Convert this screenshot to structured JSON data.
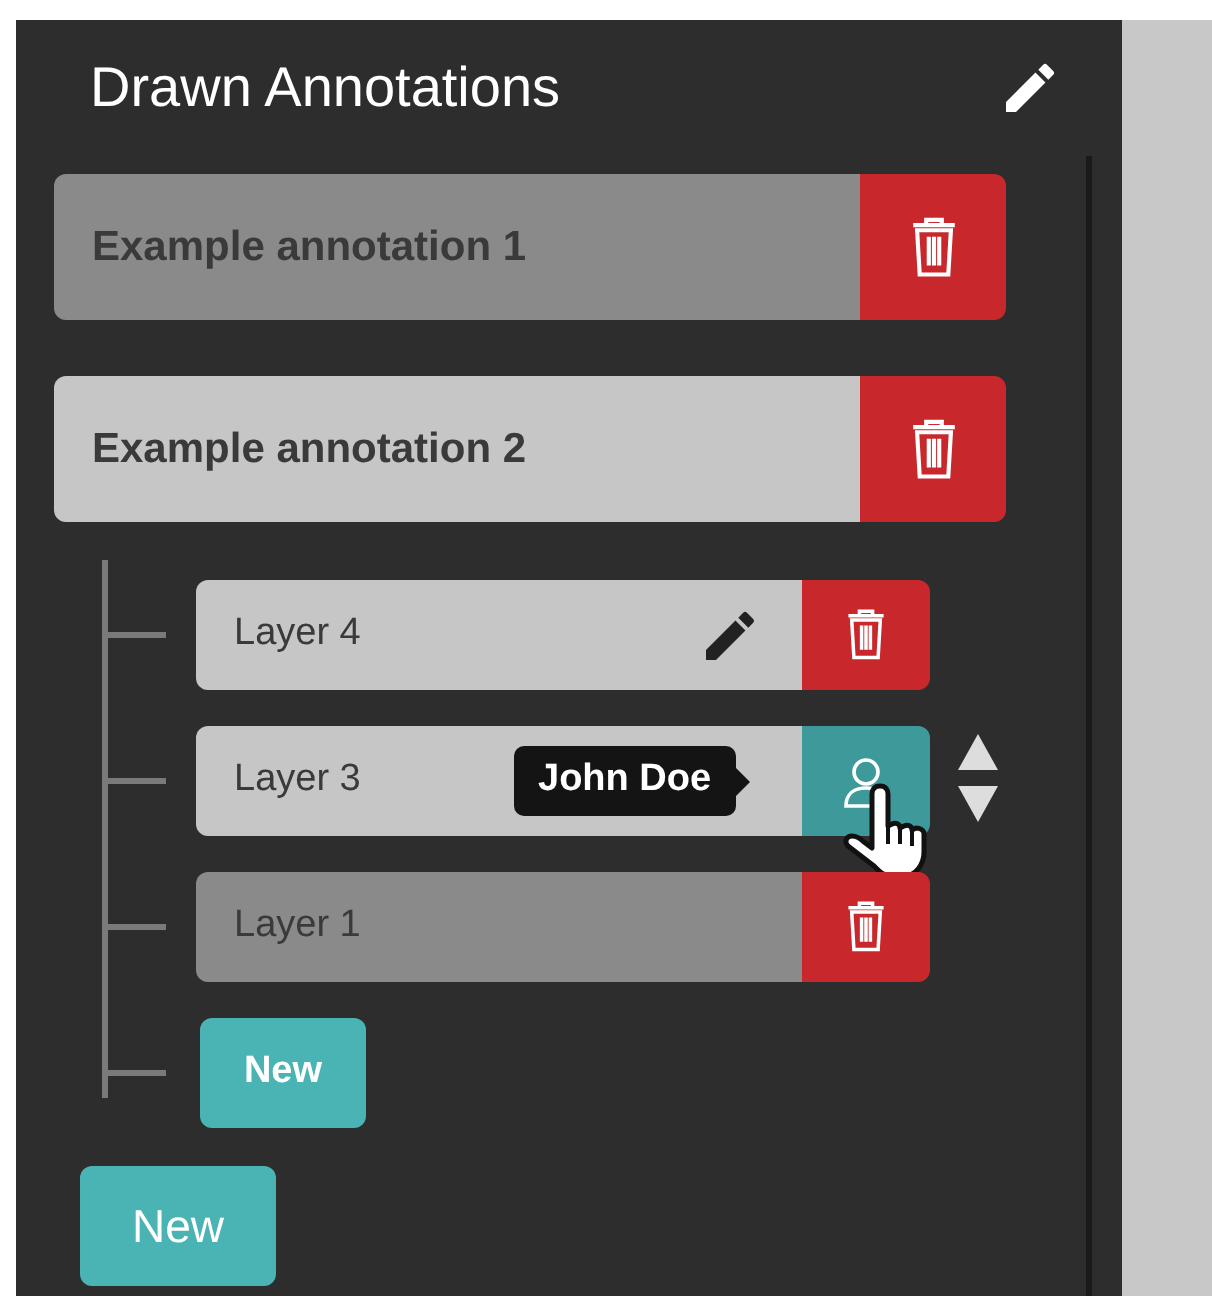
{
  "panel": {
    "title": "Drawn Annotations"
  },
  "annotations": [
    {
      "name": "Example annotation 1",
      "visible": false
    },
    {
      "name": "Example annotation 2",
      "visible": true,
      "layers": [
        {
          "name": "Layer 4",
          "visible": true,
          "editing": true,
          "hovered": false,
          "kind": "delete"
        },
        {
          "name": "Layer 3",
          "visible": true,
          "editing": false,
          "hovered": true,
          "kind": "owner",
          "tooltip": "John Doe"
        },
        {
          "name": "Layer 1",
          "visible": false,
          "editing": false,
          "hovered": false,
          "kind": "delete"
        }
      ],
      "new_layer_button": "New"
    }
  ],
  "new_annotation_button": "New"
}
